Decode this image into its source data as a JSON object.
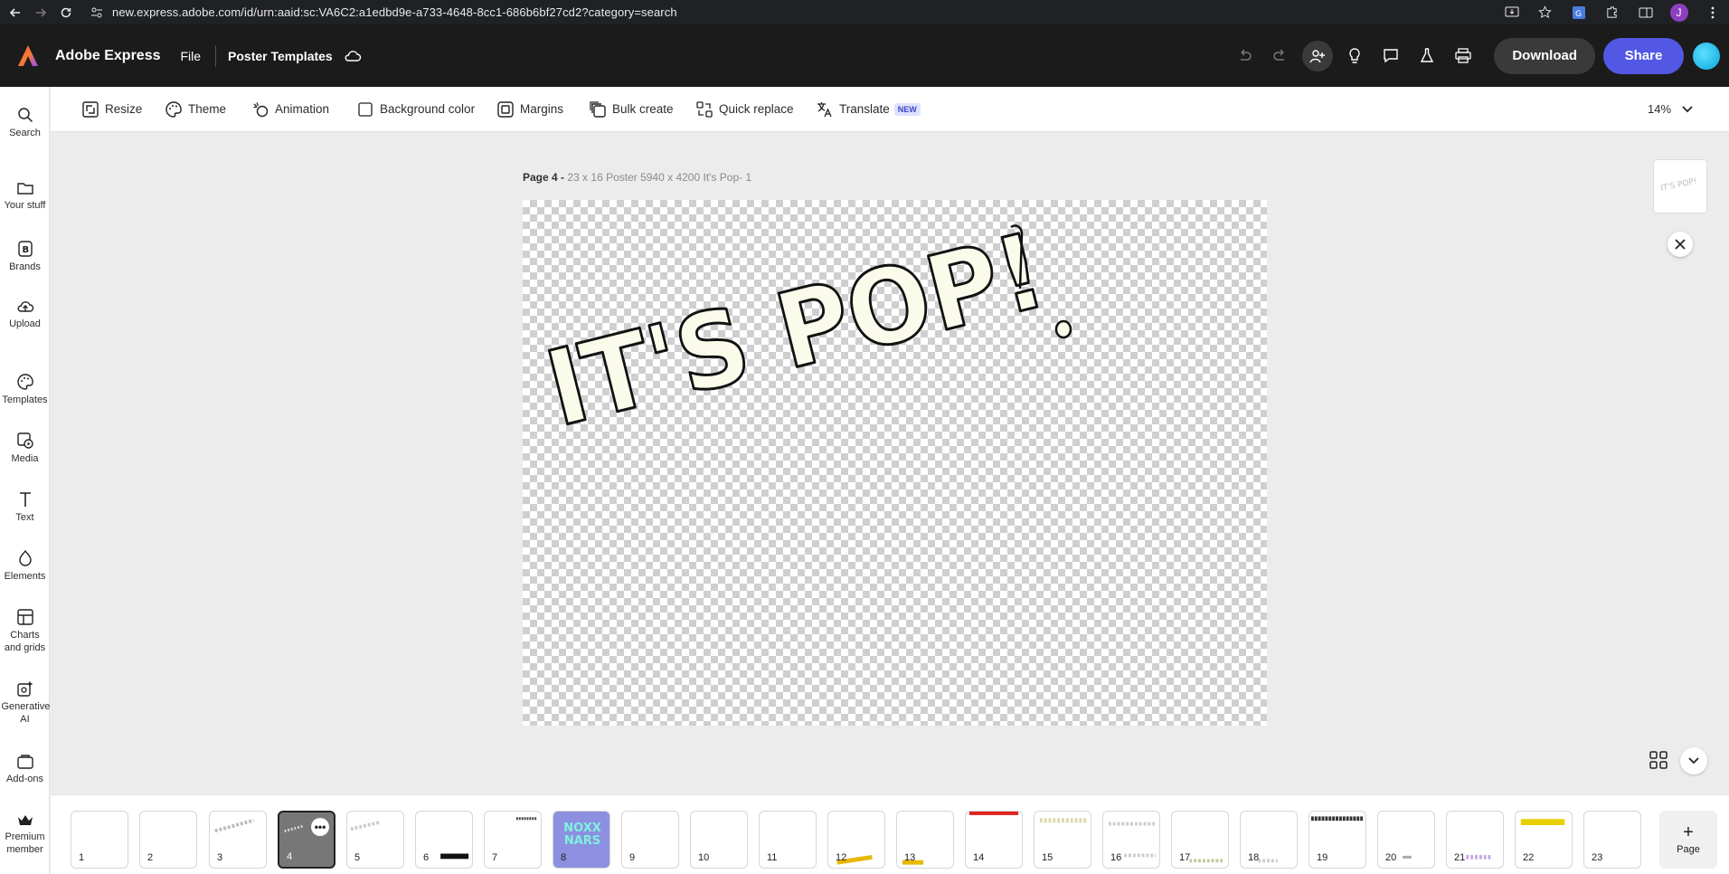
{
  "browser": {
    "url": "new.express.adobe.com/id/urn:aaid:sc:VA6C2:a1edbd9e-a733-4648-8cc1-686b6bf27cd2?category=search",
    "profile_initial": "J"
  },
  "header": {
    "app_name": "Adobe Express",
    "file_menu": "File",
    "doc_title": "Poster Templates",
    "download_label": "Download",
    "share_label": "Share",
    "accent_color": "#5258e4"
  },
  "left_rail": {
    "items": [
      {
        "label": "Search",
        "icon": "search-icon"
      },
      {
        "label": "Your stuff",
        "icon": "folder-icon"
      },
      {
        "label": "Brands",
        "icon": "brand-icon"
      },
      {
        "label": "Upload",
        "icon": "upload-icon"
      },
      {
        "label": "Templates",
        "icon": "templates-icon"
      },
      {
        "label": "Media",
        "icon": "media-icon"
      },
      {
        "label": "Text",
        "icon": "text-icon"
      },
      {
        "label": "Elements",
        "icon": "elements-icon"
      },
      {
        "label": "Charts and grids",
        "icon": "charts-icon"
      },
      {
        "label": "Generative AI",
        "icon": "generative-ai-icon"
      },
      {
        "label": "Add-ons",
        "icon": "add-ons-icon"
      },
      {
        "label": "Premium member",
        "icon": "crown-icon"
      }
    ]
  },
  "toolbar": {
    "items": [
      {
        "label": "Resize"
      },
      {
        "label": "Theme"
      },
      {
        "label": "Animation"
      },
      {
        "label": "Background color"
      },
      {
        "label": "Margins"
      },
      {
        "label": "Bulk create"
      },
      {
        "label": "Quick replace"
      },
      {
        "label": "Translate",
        "badge": "NEW"
      }
    ],
    "zoom": "14%"
  },
  "canvas": {
    "page_label": "Page 4 -",
    "page_meta": "23 x 16 Poster 5940 x 4200 It's Pop- 1",
    "artwork_text": "IT'S POP!"
  },
  "pages": {
    "selected": 4,
    "numbers": [
      "1",
      "2",
      "3",
      "4",
      "5",
      "6",
      "7",
      "8",
      "9",
      "10",
      "11",
      "12",
      "13",
      "14",
      "15",
      "16",
      "17",
      "18",
      "19",
      "20",
      "21",
      "22",
      "23"
    ],
    "add_label": "Page",
    "thumb_8_text": "NOXX NARS"
  }
}
